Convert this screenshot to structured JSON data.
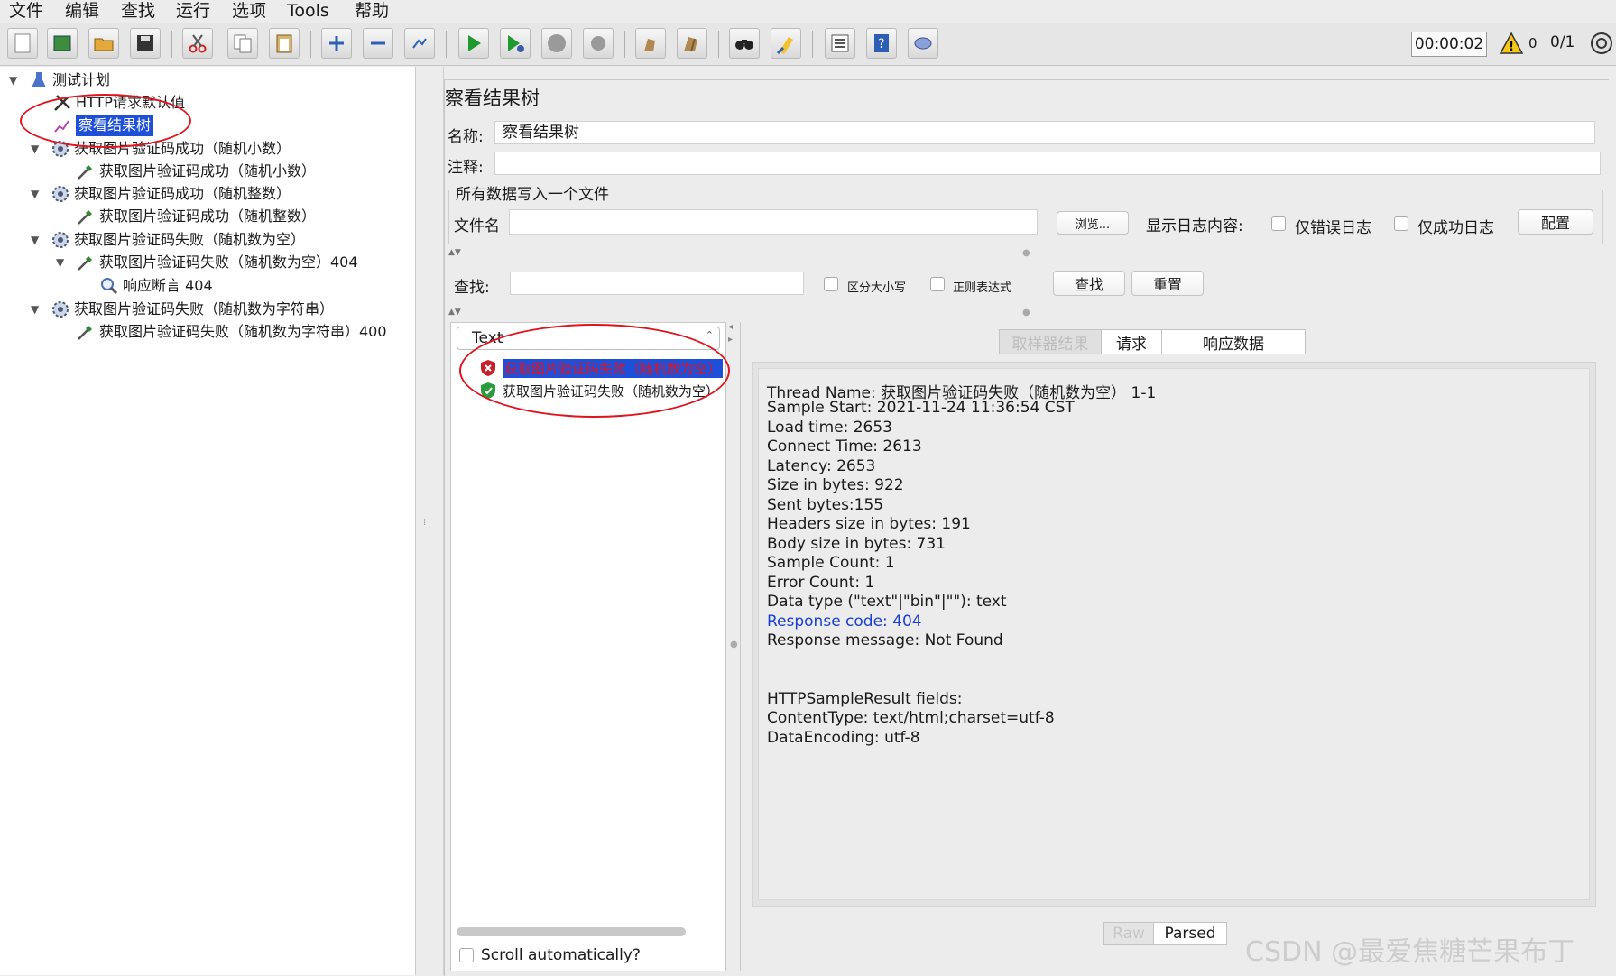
{
  "menu": [
    "文件",
    "编辑",
    "查找",
    "运行",
    "选项",
    "Tools",
    "帮助"
  ],
  "toolbar": {
    "timer": "00:00:02",
    "warning_count": "0",
    "thread_count": "0/1",
    "icons": [
      "new-icon",
      "templates-icon",
      "open-icon",
      "save-icon",
      "cut-icon",
      "copy-icon",
      "paste-icon",
      "expand-icon",
      "collapse-icon",
      "toggle-icon",
      "start-icon",
      "start-no-pause-icon",
      "stop-icon",
      "shutdown-icon",
      "clear-icon",
      "clear-all-icon",
      "search-icon",
      "reset-search-icon",
      "function-helper-icon",
      "help-icon",
      "log-viewer-icon"
    ]
  },
  "tree": {
    "root": "测试计划",
    "items": [
      {
        "label": "HTTP请求默认值",
        "icon": "tools-icon"
      },
      {
        "label": "察看结果树",
        "icon": "graph-icon"
      },
      {
        "label": "获取图片验证码成功（随机小数）",
        "icon": "gear-icon"
      },
      {
        "label": "获取图片验证码成功（随机小数）",
        "icon": "pipette-icon"
      },
      {
        "label": "获取图片验证码成功（随机整数）",
        "icon": "gear-icon"
      },
      {
        "label": "获取图片验证码成功（随机整数）",
        "icon": "pipette-icon"
      },
      {
        "label": "获取图片验证码失败（随机数为空）",
        "icon": "gear-icon"
      },
      {
        "label": "获取图片验证码失败（随机数为空）404",
        "icon": "pipette-icon"
      },
      {
        "label": "响应断言 404",
        "icon": "magnifier-icon"
      },
      {
        "label": "获取图片验证码失败（随机数为字符串）",
        "icon": "gear-icon"
      },
      {
        "label": "获取图片验证码失败（随机数为字符串）400",
        "icon": "pipette-icon"
      }
    ]
  },
  "panel": {
    "title": "察看结果树",
    "name_label": "名称:",
    "name_value": "察看结果树",
    "comment_label": "注释:",
    "comment_value": "",
    "file_section": "所有数据写入一个文件",
    "filename_label": "文件名",
    "filename_value": "",
    "browse_button": "浏览...",
    "log_label": "显示日志内容:",
    "errors_only": "仅错误日志",
    "success_only": "仅成功日志",
    "config_button": "配置"
  },
  "search": {
    "label": "查找:",
    "value": "",
    "case_sensitive": "区分大小写",
    "regex": "正则表达式",
    "find_button": "查找",
    "reset_button": "重置"
  },
  "results": {
    "renderer": "Text",
    "samples": [
      {
        "label": "获取图片验证码失败（随机数为空）",
        "status": "fail"
      },
      {
        "label": "获取图片验证码失败（随机数为空）",
        "status": "pass"
      }
    ],
    "tabs": [
      "取样器结果",
      "请求",
      "响应数据"
    ],
    "active_tab": "取样器结果",
    "sample_result": [
      "Thread Name: 获取图片验证码失败（随机数为空） 1-1",
      "Sample Start: 2021-11-24 11:36:54 CST",
      "Load time: 2653",
      "Connect Time: 2613",
      "Latency: 2653",
      "Size in bytes: 922",
      "Sent bytes:155",
      "Headers size in bytes: 191",
      "Body size in bytes: 731",
      "Sample Count: 1",
      "Error Count: 1",
      "Data type (\"text\"|\"bin\"|\"\"): text",
      "Response code: 404",
      "Response message: Not Found",
      "",
      "",
      "HTTPSampleResult fields:",
      "ContentType: text/html;charset=utf-8",
      "DataEncoding: utf-8"
    ],
    "bottom_tabs": [
      "Raw",
      "Parsed"
    ],
    "scroll_auto": "Scroll automatically?"
  },
  "watermark": "CSDN @最爱焦糖芒果布丁",
  "colors": {
    "selection": "#1d4fd8",
    "annotation": "#e0141e",
    "link": "#1a3fd1"
  }
}
